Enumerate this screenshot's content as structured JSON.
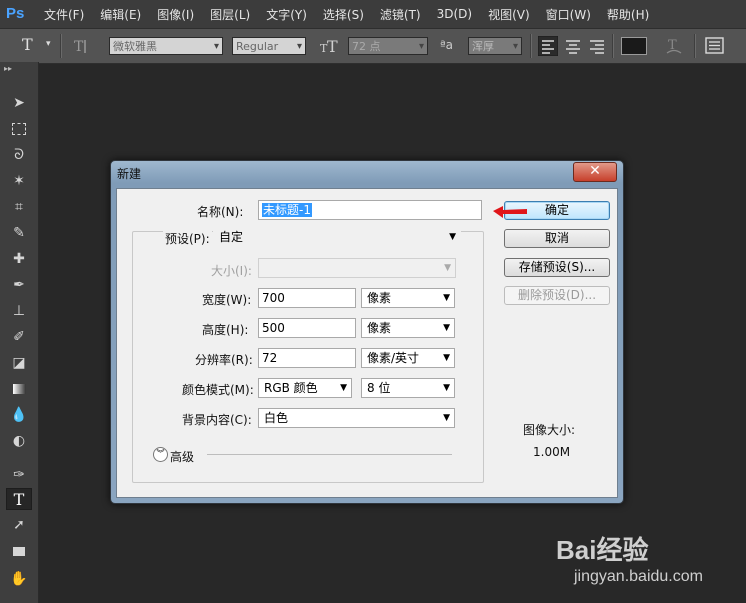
{
  "app": {
    "logo": "Ps"
  },
  "menu": [
    "文件(F)",
    "编辑(E)",
    "图像(I)",
    "图层(L)",
    "文字(Y)",
    "选择(S)",
    "滤镜(T)",
    "3D(D)",
    "视图(V)",
    "窗口(W)",
    "帮助(H)"
  ],
  "options_bar": {
    "tool_glyph": "T",
    "font_family": "微软雅黑",
    "font_style": "Regular",
    "font_size": "72 点",
    "aa_label": "ªa",
    "antialias": "浑厚"
  },
  "dialog": {
    "title": "新建",
    "close_symbol": "✕",
    "name_label": "名称(N):",
    "name_value": "未标题-1",
    "preset_label": "预设(P):",
    "preset_value": "自定",
    "size_label": "大小(I):",
    "size_value": "",
    "width_label": "宽度(W):",
    "width_value": "700",
    "width_unit": "像素",
    "height_label": "高度(H):",
    "height_value": "500",
    "height_unit": "像素",
    "resolution_label": "分辨率(R):",
    "resolution_value": "72",
    "resolution_unit": "像素/英寸",
    "color_mode_label": "颜色模式(M):",
    "color_mode_value": "RGB 颜色",
    "bit_depth_value": "8 位",
    "background_label": "背景内容(C):",
    "background_value": "白色",
    "advanced_label": "高级",
    "ok_button": "确定",
    "cancel_button": "取消",
    "save_preset_button": "存储预设(S)...",
    "delete_preset_button": "删除预设(D)...",
    "image_size_label": "图像大小:",
    "image_size_value": "1.00M"
  },
  "watermark": {
    "brand": "Bai经验",
    "url": "jingyan.baidu.com"
  },
  "colors": {
    "accent_arrow": "#e0161a",
    "default_button": "#bee6fd",
    "selection": "#3399ff"
  }
}
